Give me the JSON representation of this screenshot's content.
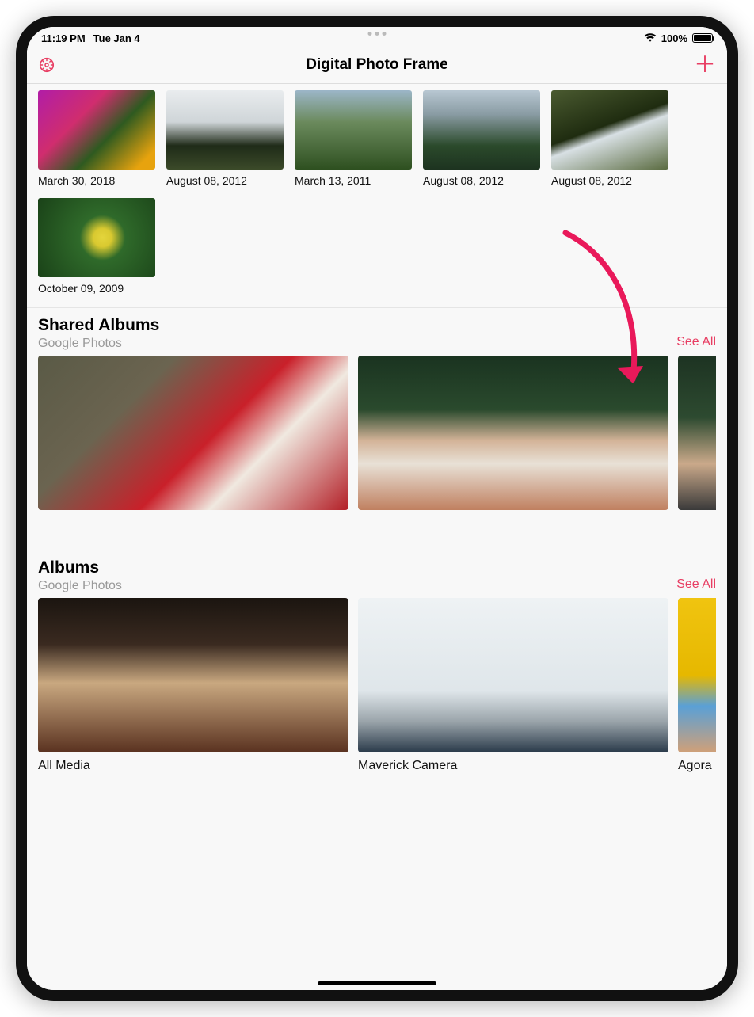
{
  "status": {
    "time": "11:19 PM",
    "date": "Tue Jan 4",
    "battery_pct": "100%"
  },
  "nav": {
    "title": "Digital Photo Frame"
  },
  "top_grid": [
    {
      "caption": "March 30, 2018"
    },
    {
      "caption": "August 08, 2012"
    },
    {
      "caption": "March 13, 2011"
    },
    {
      "caption": "August 08, 2012"
    },
    {
      "caption": "August 08, 2012"
    },
    {
      "caption": "October 09, 2009"
    }
  ],
  "shared": {
    "title": "Shared Albums",
    "subtitle": "Google Photos",
    "see_all": "See All"
  },
  "albums": {
    "title": "Albums",
    "subtitle": "Google Photos",
    "see_all": "See All",
    "items": [
      {
        "name": "All Media"
      },
      {
        "name": "Maverick Camera"
      },
      {
        "name": "Agora"
      }
    ]
  },
  "accent": "#e83e63"
}
